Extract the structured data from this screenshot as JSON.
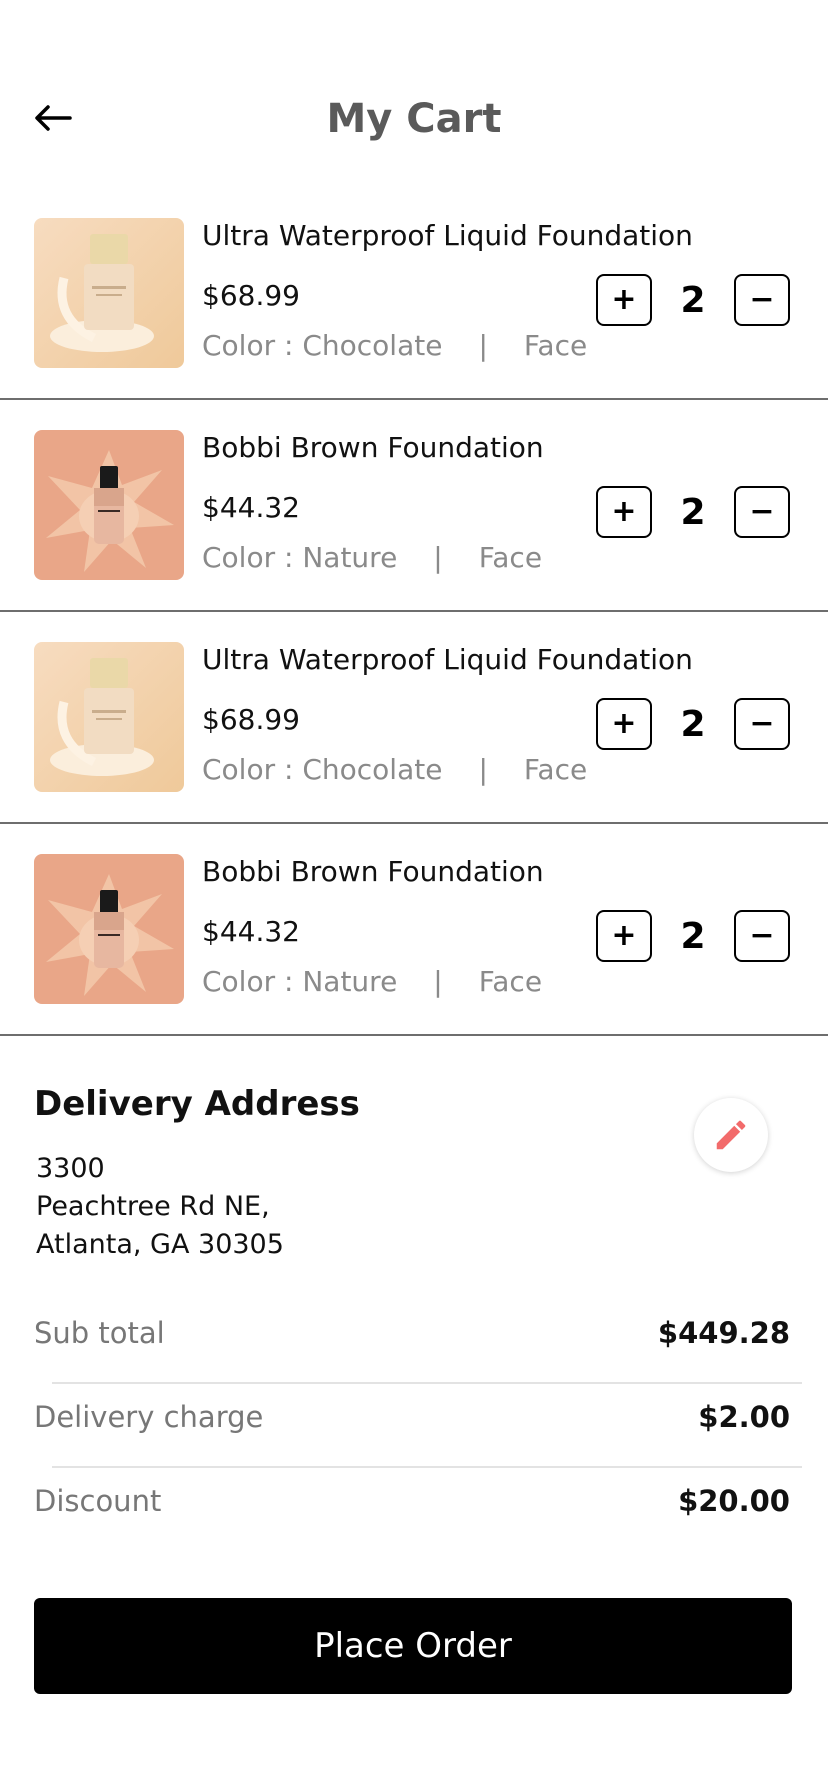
{
  "header": {
    "title": "My Cart"
  },
  "cart": {
    "items": [
      {
        "name": "Ultra Waterproof Liquid Foundation",
        "price": "$68.99",
        "color": "Color : Chocolate",
        "separator": "|",
        "category": "Face",
        "qty": "2",
        "plus": "+",
        "minus": "−"
      },
      {
        "name": "Bobbi Brown Foundation",
        "price": "$44.32",
        "color": "Color : Nature",
        "separator": "|",
        "category": "Face",
        "qty": "2",
        "plus": "+",
        "minus": "−"
      },
      {
        "name": "Ultra Waterproof Liquid Foundation",
        "price": "$68.99",
        "color": "Color : Chocolate",
        "separator": "|",
        "category": "Face",
        "qty": "2",
        "plus": "+",
        "minus": "−"
      },
      {
        "name": "Bobbi Brown Foundation",
        "price": "$44.32",
        "color": "Color : Nature",
        "separator": "|",
        "category": "Face",
        "qty": "2",
        "plus": "+",
        "minus": "−"
      }
    ]
  },
  "delivery": {
    "title": "Delivery Address",
    "line1": "3300",
    "line2": "Peachtree Rd NE,",
    "line3": "Atlanta, GA 30305"
  },
  "summary": {
    "subtotal_label": "Sub total",
    "subtotal_value": "$449.28",
    "delivery_label": "Delivery charge",
    "delivery_value": "$2.00",
    "discount_label": "Discount",
    "discount_value": "$20.00"
  },
  "actions": {
    "place_order": "Place Order"
  },
  "colors": {
    "accent": "#f26b6b",
    "title_gray": "#5a5a5a",
    "meta_gray": "#8a8a8a",
    "button_bg": "#000000"
  }
}
